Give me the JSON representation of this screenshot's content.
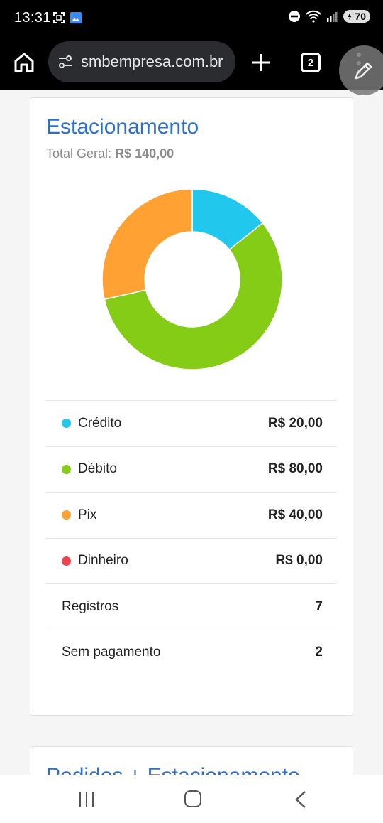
{
  "status_bar": {
    "time": "13:31",
    "battery": "70",
    "icons": [
      "screenshot-icon",
      "gallery-icon",
      "dnd-icon",
      "wifi-icon",
      "signal-icon",
      "battery-icon"
    ]
  },
  "browser": {
    "url": "smbempresa.com.br",
    "tab_count": "2",
    "icons": [
      "home-icon",
      "site-settings-icon",
      "plus-icon",
      "tabs-icon",
      "menu-icon",
      "edit-icon"
    ]
  },
  "card": {
    "title": "Estacionamento",
    "total_label": "Total Geral:",
    "total_value": "R$ 140,00",
    "rows": [
      {
        "label": "Crédito",
        "value": "R$ 20,00",
        "color": "#22c7ee"
      },
      {
        "label": "Débito",
        "value": "R$ 80,00",
        "color": "#84cc16"
      },
      {
        "label": "Pix",
        "value": "R$ 40,00",
        "color": "#ffa233"
      },
      {
        "label": "Dinheiro",
        "value": "R$ 0,00",
        "color": "#f0424f"
      },
      {
        "label": "Registros",
        "value": "7"
      },
      {
        "label": "Sem pagamento",
        "value": "2"
      }
    ]
  },
  "chart_data": {
    "type": "pie",
    "categories": [
      "Crédito",
      "Débito",
      "Pix",
      "Dinheiro"
    ],
    "values": [
      20,
      80,
      40,
      0
    ],
    "colors": [
      "#22c7ee",
      "#84cc16",
      "#ffa233",
      "#f0424f"
    ],
    "donut": true,
    "title": "",
    "legend": "none"
  },
  "card2": {
    "title": "Pedidos + Estacionamento"
  },
  "navbar": {
    "icons": [
      "recents-icon",
      "home-nav-icon",
      "back-icon"
    ]
  }
}
